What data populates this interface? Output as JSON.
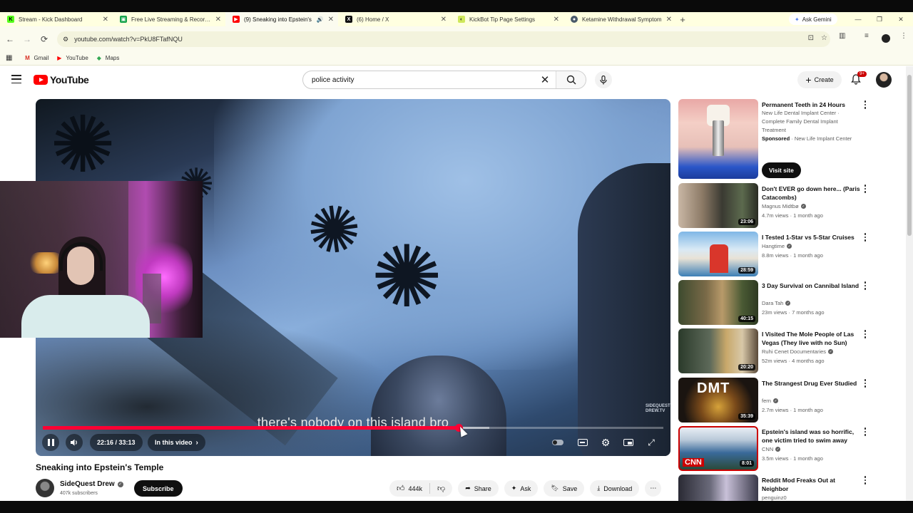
{
  "browser": {
    "tabs": [
      {
        "title": "Stream - Kick Dashboard",
        "fav": "K",
        "color": "#53fc18"
      },
      {
        "title": "Free Live Streaming & Recordin",
        "fav": "▣",
        "color": "#16a34a"
      },
      {
        "title": "(9) Sneaking into Epstein's",
        "fav": "▶",
        "color": "#ff0000"
      },
      {
        "title": "(6) Home / X",
        "fav": "X",
        "color": "#111111"
      },
      {
        "title": "KickBot Tip Page Settings",
        "fav": "◐",
        "color": "#cfe85a"
      },
      {
        "title": "Ketamine Withdrawal Symptom",
        "fav": "●",
        "color": "#4a5a6a"
      }
    ],
    "ask_gemini": "Ask Gemini",
    "url": "youtube.com/watch?v=PkU8FTafNQU",
    "bookmarks": [
      {
        "label": "Gmail",
        "icon": "M",
        "color": "#d93025"
      },
      {
        "label": "YouTube",
        "icon": "▶",
        "color": "#ff0000"
      },
      {
        "label": "Maps",
        "icon": "◆",
        "color": "#34a853"
      }
    ]
  },
  "youtube": {
    "logo": "YouTube",
    "search_query": "police  activity",
    "create_label": "Create",
    "notif_badge": "9+"
  },
  "player": {
    "subtitle": "there's nobody on this island bro",
    "watermark_1": "SIDEQUEST",
    "watermark_2": "DREW.TV",
    "time": "22:16 / 33:13",
    "in_this_video": "In this video",
    "progress_fraction": 0.6703,
    "loaded_fraction": 0.72
  },
  "video": {
    "title": "Sneaking into Epstein's Temple",
    "channel": "SideQuest Drew",
    "subscribers": "407k subscribers",
    "subscribe_label": "Subscribe",
    "likes": "444k",
    "share": "Share",
    "ask": "Ask",
    "save": "Save",
    "download": "Download"
  },
  "sidebar": {
    "ad": {
      "title": "Permanent Teeth in 24 Hours",
      "line1": "New Life Dental Implant Center ·",
      "line2": "Complete Family Dental Implant",
      "line3": "Treatment",
      "sponsored": "Sponsored",
      "advertiser": "· New Life Implant Center",
      "cta": "Visit site"
    },
    "items": [
      {
        "title": "Don't EVER go down here... (Paris Catacombs)",
        "channel": "Magnus Midtbø",
        "meta": "4.7m views · 1 month ago",
        "duration": "23:06",
        "verified": true
      },
      {
        "title": "I Tested 1-Star vs 5-Star Cruises",
        "channel": "Hangtime",
        "meta": "8.8m views · 1 month ago",
        "duration": "28:59",
        "verified": true
      },
      {
        "title": "3 Day Survival on Cannibal Island",
        "channel": "Dara Tah",
        "meta": "23m views · 7 months ago",
        "duration": "40:15",
        "verified": true
      },
      {
        "title": "I Visited The Mole People of Las Vegas (They live with no Sun)",
        "channel": "Ruhi Cenet Documentaries",
        "meta": "52m views · 4 months ago",
        "duration": "20:20",
        "verified": true
      },
      {
        "title": "The Strangest Drug Ever Studied",
        "channel": "fern",
        "meta": "2.7m views · 1 month ago",
        "duration": "35:39",
        "verified": true
      },
      {
        "title": "Epstein's island was so horrific, one victim tried to swim away",
        "channel": "CNN",
        "meta": "3.5m views · 1 month ago",
        "duration": "8:01",
        "verified": true
      },
      {
        "title": "Reddit Mod Freaks Out at Neighbor",
        "channel": "penguinz0",
        "meta": "",
        "duration": "",
        "verified": true
      }
    ]
  }
}
